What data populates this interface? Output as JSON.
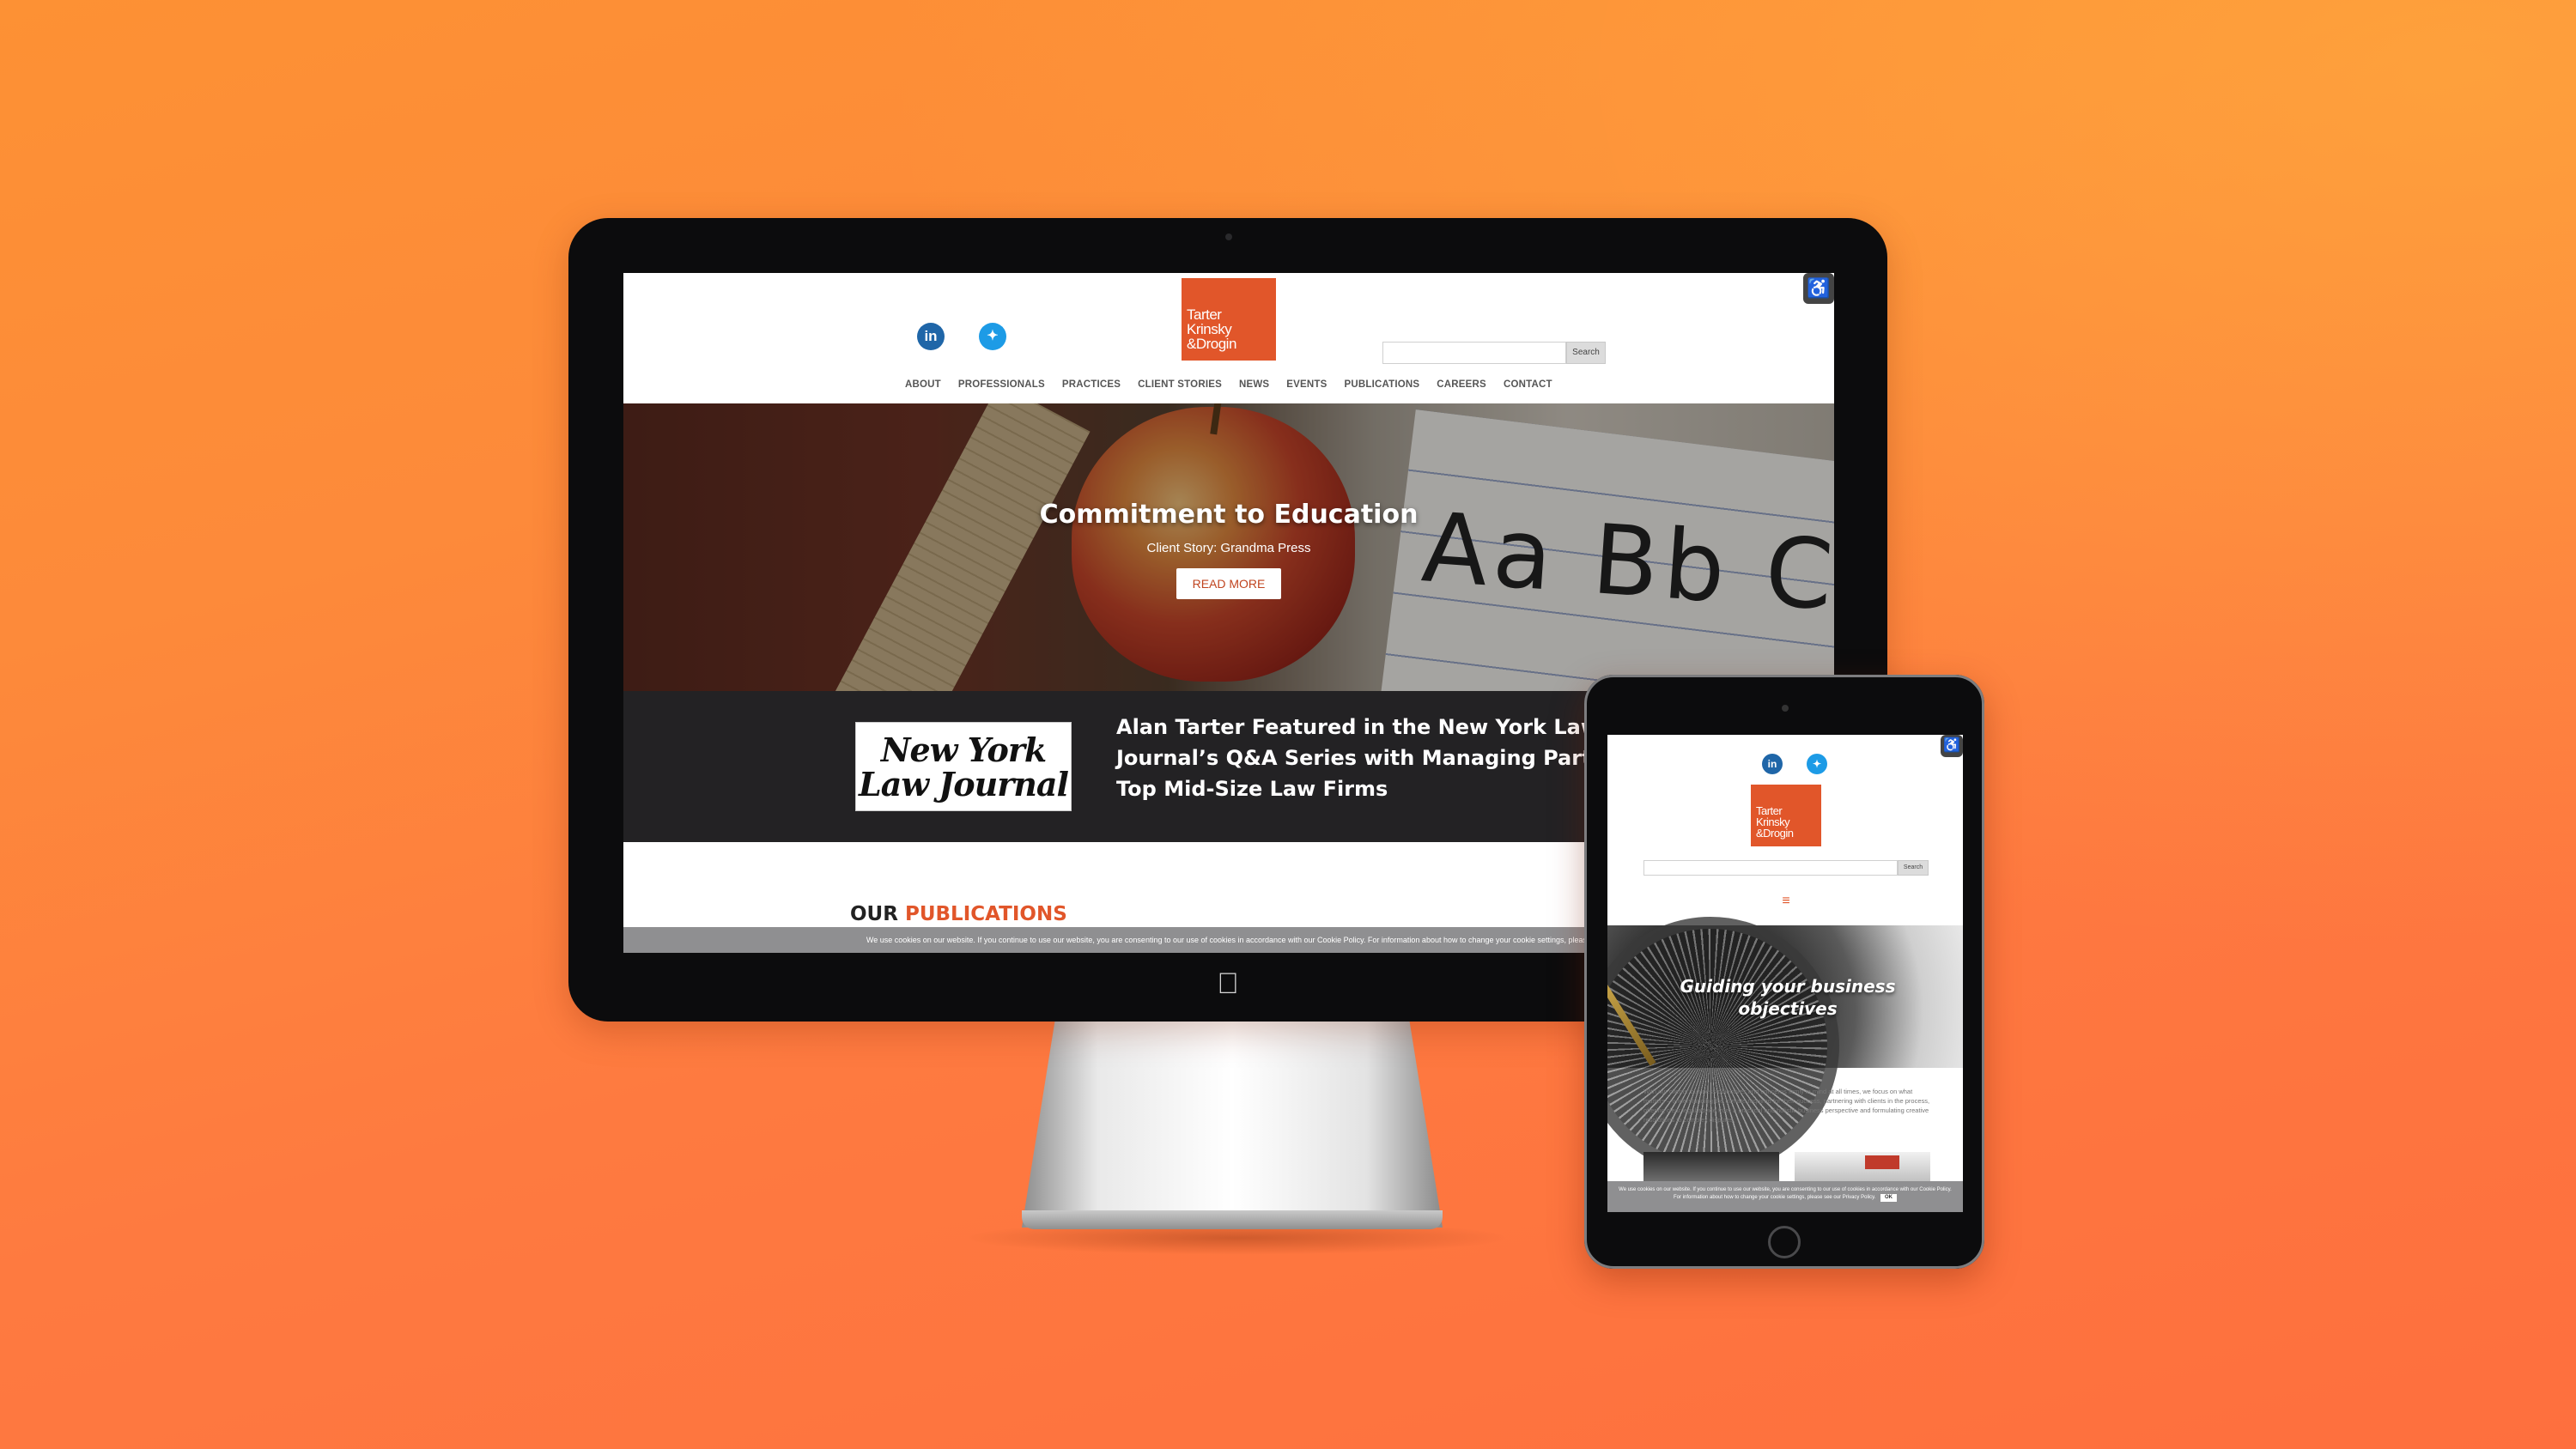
{
  "desktop": {
    "social": {
      "linkedin": "in",
      "twitter": "twitter-bird"
    },
    "logo": {
      "line1": "Tarter",
      "line2": "Krinsky",
      "line3": "&Drogin"
    },
    "search": {
      "placeholder": "",
      "button": "Search"
    },
    "nav": [
      "ABOUT",
      "PROFESSIONALS",
      "PRACTICES",
      "CLIENT STORIES",
      "NEWS",
      "EVENTS",
      "PUBLICATIONS",
      "CAREERS",
      "CONTACT"
    ],
    "hero": {
      "title": "Commitment to Education",
      "subtitle": "Client Story: Grandma Press",
      "button": "READ MORE",
      "letters": "Aa Bb C"
    },
    "news": {
      "logo_line1": "New York",
      "logo_line2": "Law Journal",
      "headline_line1": "Alan Tarter Featured in the New York Law",
      "headline_line2": "Journal’s Q&A Series with Managing Partners a",
      "headline_line3": "Top Mid-Size Law Firms"
    },
    "publications": {
      "prefix": "OUR",
      "highlight": "PUBLICATIONS"
    },
    "cookie": "We use cookies on our website. If you continue to use our website, you are consenting to our use of cookies in accordance with our Cookie Policy. For information about how to change your cookie settings, please"
  },
  "tablet": {
    "logo": {
      "line1": "Tarter",
      "line2": "Krinsky",
      "line3": "&Drogin"
    },
    "search": {
      "button": "Search"
    },
    "menu_icon": "≡",
    "hero": {
      "title_line1": "Guiding your business",
      "title_line2": "objectives"
    },
    "paragraph": "With our clients’ business objectives and concerns firmly in mind at all times, we focus on what matters – understanding the climate required for their success, partnering with clients in the process, offering clear legal advice from a practical and holistic business perspective and formulating creative resolutions to complex disputes.",
    "cookie": "We use cookies on our website. If you continue to use our website, you are consenting to our use of cookies in accordance with our Cookie Policy. For information about how to change your cookie settings, please see our Privacy Policy.",
    "cookie_ok": "OK"
  },
  "colors": {
    "brand_orange": "#e1562a",
    "background_gradient": [
      "#fd9134",
      "#fe6f3e"
    ],
    "news_band": "#232224"
  },
  "icons": [
    "linkedin-icon",
    "twitter-icon",
    "accessibility-icon",
    "apple-logo-icon",
    "menu-icon"
  ]
}
